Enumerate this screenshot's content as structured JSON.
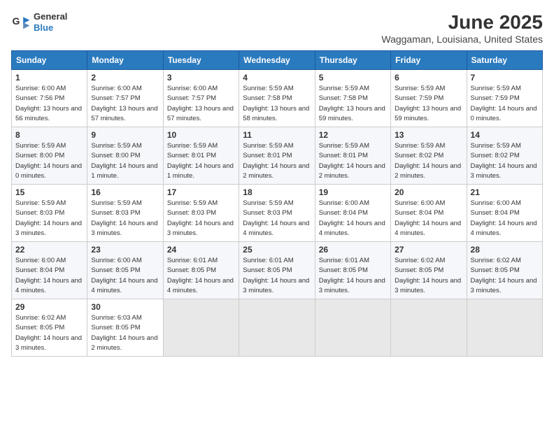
{
  "header": {
    "logo": {
      "line1": "General",
      "line2": "Blue"
    },
    "title": "June 2025",
    "subtitle": "Waggaman, Louisiana, United States"
  },
  "weekdays": [
    "Sunday",
    "Monday",
    "Tuesday",
    "Wednesday",
    "Thursday",
    "Friday",
    "Saturday"
  ],
  "weeks": [
    [
      {
        "day": "1",
        "sunrise": "Sunrise: 6:00 AM",
        "sunset": "Sunset: 7:56 PM",
        "daylight": "Daylight: 13 hours and 56 minutes."
      },
      {
        "day": "2",
        "sunrise": "Sunrise: 6:00 AM",
        "sunset": "Sunset: 7:57 PM",
        "daylight": "Daylight: 13 hours and 57 minutes."
      },
      {
        "day": "3",
        "sunrise": "Sunrise: 6:00 AM",
        "sunset": "Sunset: 7:57 PM",
        "daylight": "Daylight: 13 hours and 57 minutes."
      },
      {
        "day": "4",
        "sunrise": "Sunrise: 5:59 AM",
        "sunset": "Sunset: 7:58 PM",
        "daylight": "Daylight: 13 hours and 58 minutes."
      },
      {
        "day": "5",
        "sunrise": "Sunrise: 5:59 AM",
        "sunset": "Sunset: 7:58 PM",
        "daylight": "Daylight: 13 hours and 59 minutes."
      },
      {
        "day": "6",
        "sunrise": "Sunrise: 5:59 AM",
        "sunset": "Sunset: 7:59 PM",
        "daylight": "Daylight: 13 hours and 59 minutes."
      },
      {
        "day": "7",
        "sunrise": "Sunrise: 5:59 AM",
        "sunset": "Sunset: 7:59 PM",
        "daylight": "Daylight: 14 hours and 0 minutes."
      }
    ],
    [
      {
        "day": "8",
        "sunrise": "Sunrise: 5:59 AM",
        "sunset": "Sunset: 8:00 PM",
        "daylight": "Daylight: 14 hours and 0 minutes."
      },
      {
        "day": "9",
        "sunrise": "Sunrise: 5:59 AM",
        "sunset": "Sunset: 8:00 PM",
        "daylight": "Daylight: 14 hours and 1 minute."
      },
      {
        "day": "10",
        "sunrise": "Sunrise: 5:59 AM",
        "sunset": "Sunset: 8:01 PM",
        "daylight": "Daylight: 14 hours and 1 minute."
      },
      {
        "day": "11",
        "sunrise": "Sunrise: 5:59 AM",
        "sunset": "Sunset: 8:01 PM",
        "daylight": "Daylight: 14 hours and 2 minutes."
      },
      {
        "day": "12",
        "sunrise": "Sunrise: 5:59 AM",
        "sunset": "Sunset: 8:01 PM",
        "daylight": "Daylight: 14 hours and 2 minutes."
      },
      {
        "day": "13",
        "sunrise": "Sunrise: 5:59 AM",
        "sunset": "Sunset: 8:02 PM",
        "daylight": "Daylight: 14 hours and 2 minutes."
      },
      {
        "day": "14",
        "sunrise": "Sunrise: 5:59 AM",
        "sunset": "Sunset: 8:02 PM",
        "daylight": "Daylight: 14 hours and 3 minutes."
      }
    ],
    [
      {
        "day": "15",
        "sunrise": "Sunrise: 5:59 AM",
        "sunset": "Sunset: 8:03 PM",
        "daylight": "Daylight: 14 hours and 3 minutes."
      },
      {
        "day": "16",
        "sunrise": "Sunrise: 5:59 AM",
        "sunset": "Sunset: 8:03 PM",
        "daylight": "Daylight: 14 hours and 3 minutes."
      },
      {
        "day": "17",
        "sunrise": "Sunrise: 5:59 AM",
        "sunset": "Sunset: 8:03 PM",
        "daylight": "Daylight: 14 hours and 3 minutes."
      },
      {
        "day": "18",
        "sunrise": "Sunrise: 5:59 AM",
        "sunset": "Sunset: 8:03 PM",
        "daylight": "Daylight: 14 hours and 4 minutes."
      },
      {
        "day": "19",
        "sunrise": "Sunrise: 6:00 AM",
        "sunset": "Sunset: 8:04 PM",
        "daylight": "Daylight: 14 hours and 4 minutes."
      },
      {
        "day": "20",
        "sunrise": "Sunrise: 6:00 AM",
        "sunset": "Sunset: 8:04 PM",
        "daylight": "Daylight: 14 hours and 4 minutes."
      },
      {
        "day": "21",
        "sunrise": "Sunrise: 6:00 AM",
        "sunset": "Sunset: 8:04 PM",
        "daylight": "Daylight: 14 hours and 4 minutes."
      }
    ],
    [
      {
        "day": "22",
        "sunrise": "Sunrise: 6:00 AM",
        "sunset": "Sunset: 8:04 PM",
        "daylight": "Daylight: 14 hours and 4 minutes."
      },
      {
        "day": "23",
        "sunrise": "Sunrise: 6:00 AM",
        "sunset": "Sunset: 8:05 PM",
        "daylight": "Daylight: 14 hours and 4 minutes."
      },
      {
        "day": "24",
        "sunrise": "Sunrise: 6:01 AM",
        "sunset": "Sunset: 8:05 PM",
        "daylight": "Daylight: 14 hours and 4 minutes."
      },
      {
        "day": "25",
        "sunrise": "Sunrise: 6:01 AM",
        "sunset": "Sunset: 8:05 PM",
        "daylight": "Daylight: 14 hours and 3 minutes."
      },
      {
        "day": "26",
        "sunrise": "Sunrise: 6:01 AM",
        "sunset": "Sunset: 8:05 PM",
        "daylight": "Daylight: 14 hours and 3 minutes."
      },
      {
        "day": "27",
        "sunrise": "Sunrise: 6:02 AM",
        "sunset": "Sunset: 8:05 PM",
        "daylight": "Daylight: 14 hours and 3 minutes."
      },
      {
        "day": "28",
        "sunrise": "Sunrise: 6:02 AM",
        "sunset": "Sunset: 8:05 PM",
        "daylight": "Daylight: 14 hours and 3 minutes."
      }
    ],
    [
      {
        "day": "29",
        "sunrise": "Sunrise: 6:02 AM",
        "sunset": "Sunset: 8:05 PM",
        "daylight": "Daylight: 14 hours and 3 minutes."
      },
      {
        "day": "30",
        "sunrise": "Sunrise: 6:03 AM",
        "sunset": "Sunset: 8:05 PM",
        "daylight": "Daylight: 14 hours and 2 minutes."
      },
      null,
      null,
      null,
      null,
      null
    ]
  ]
}
